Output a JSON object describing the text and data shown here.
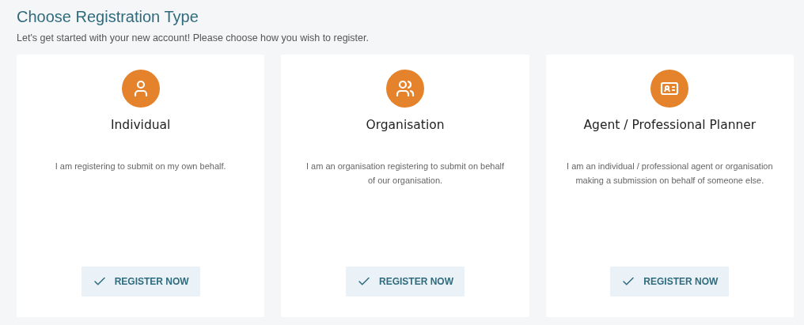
{
  "header": {
    "title": "Choose Registration Type",
    "subtitle": "Let's get started with your new account! Please choose how you wish to register."
  },
  "options": [
    {
      "kind": "person",
      "title": "Individual",
      "description": "I am registering to submit on my own behalf.",
      "button": "REGISTER NOW"
    },
    {
      "kind": "group",
      "title": "Organisation",
      "description": "I am an organisation registering to submit on behalf of our organisation.",
      "button": "REGISTER NOW"
    },
    {
      "kind": "card",
      "title": "Agent / Professional Planner",
      "description": "I am an individual / professional agent or organisation making a submission on behalf of someone else.",
      "button": "REGISTER NOW"
    }
  ]
}
